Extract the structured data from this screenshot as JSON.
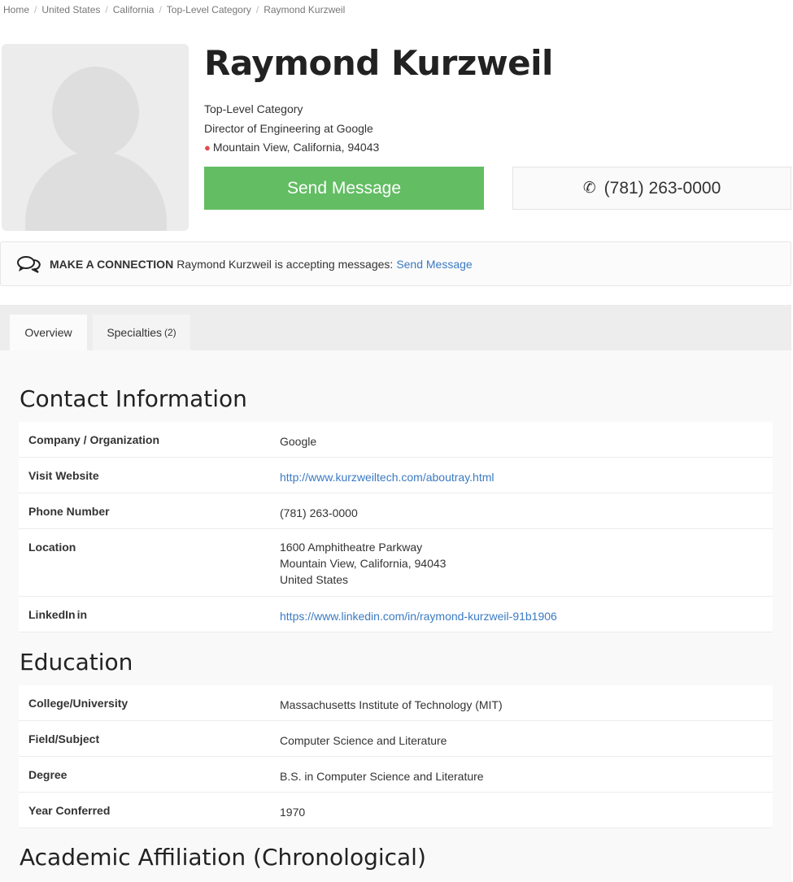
{
  "breadcrumb": {
    "items": [
      "Home",
      "United States",
      "California",
      "Top-Level Category"
    ],
    "current": "Raymond Kurzweil"
  },
  "profile": {
    "name": "Raymond Kurzweil",
    "category": "Top-Level Category",
    "title": "Director of Engineering at Google",
    "location": "Mountain View, California, 94043",
    "send_label": "Send Message",
    "phone": "(781) 263-0000"
  },
  "connect": {
    "title": "MAKE A CONNECTION",
    "text": "Raymond Kurzweil is accepting messages:",
    "link": "Send Message"
  },
  "tabs": [
    {
      "label": "Overview",
      "count": ""
    },
    {
      "label": "Specialties",
      "count": "(2)"
    }
  ],
  "contact": {
    "heading": "Contact Information",
    "company_label": "Company / Organization",
    "company": "Google",
    "website_label": "Visit Website",
    "website": "http://www.kurzweiltech.com/aboutray.html",
    "phone_label": "Phone Number",
    "phone": "(781) 263-0000",
    "location_label": "Location",
    "address_line1": "1600 Amphitheatre Parkway",
    "address_line2": "Mountain View, California, 94043",
    "address_line3": "United States",
    "linkedin_label": "LinkedIn",
    "linkedin_icon": "in",
    "linkedin": "https://www.linkedin.com/in/raymond-kurzweil-91b1906"
  },
  "education": {
    "heading": "Education",
    "college_label": "College/University",
    "college": "Massachusetts Institute of Technology (MIT)",
    "field_label": "Field/Subject",
    "field": "Computer Science and Literature",
    "degree_label": "Degree",
    "degree": "B.S. in Computer Science and Literature",
    "year_label": "Year Conferred",
    "year": "1970"
  },
  "academic": {
    "heading": "Academic Affiliation (Chronological)"
  },
  "colors": {
    "send_button": "#63bd63",
    "link": "#3b7ac2",
    "pin": "#e04c4c"
  },
  "icons": [
    "map-pin-icon",
    "phone-icon",
    "chat-bubbles-icon",
    "linkedin-icon"
  ]
}
